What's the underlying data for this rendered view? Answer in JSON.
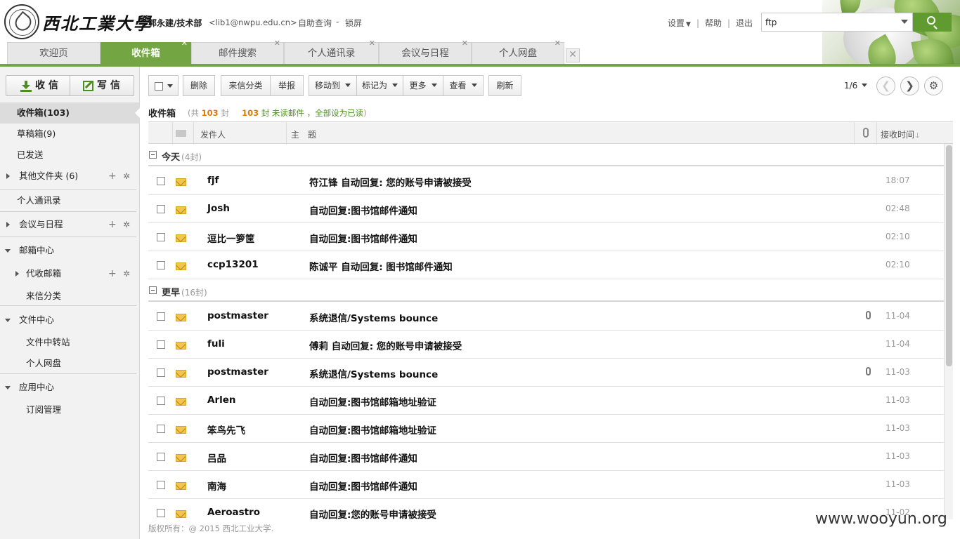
{
  "header": {
    "school_name": "西北工業大學",
    "user_name": "郭永建/技术部",
    "user_email": "<lib1@nwpu.edu.cn>",
    "self_query": "自助查询",
    "separator": "-",
    "lock_screen": "锁屏",
    "settings": "设置",
    "help": "帮助",
    "logout": "退出",
    "search_value": "ftp"
  },
  "tabs": [
    {
      "label": "欢迎页"
    },
    {
      "label": "收件箱"
    },
    {
      "label": "邮件搜索"
    },
    {
      "label": "个人通讯录"
    },
    {
      "label": "会议与日程"
    },
    {
      "label": "个人网盘"
    }
  ],
  "sidebar": {
    "receive_label": "收 信",
    "compose_label": "写 信",
    "folders": {
      "inbox": "收件箱(103)",
      "drafts": "草稿箱(9)",
      "sent": "已发送",
      "other": "其他文件夹 (6)",
      "contacts": "个人通讯录",
      "meetings": "会议与日程",
      "mailbox_center": "邮箱中心",
      "proxy_mailbox": "代收邮箱",
      "mail_classify": "来信分类",
      "file_center": "文件中心",
      "file_transfer": "文件中转站",
      "netdisk": "个人网盘",
      "app_center": "应用中心",
      "subscription": "订阅管理"
    }
  },
  "toolbar": {
    "delete": "删除",
    "classify": "来信分类",
    "report": "举报",
    "move_to": "移动到",
    "mark_as": "标记为",
    "more": "更多",
    "view": "查看",
    "refresh": "刷新",
    "page": "1/6"
  },
  "inbox": {
    "title": "收件箱",
    "total_prefix": "(共",
    "total_count": "103",
    "total_suffix": "封",
    "unread_count": "103",
    "unread_suffix": "封 未读邮件",
    "mark_all_read": "，全部设为已读",
    "close_paren": ")"
  },
  "list_header": {
    "sender": "发件人",
    "subject": "主　题",
    "time": "接收时间"
  },
  "groups": {
    "today": {
      "label": "今天",
      "count": "(4封)"
    },
    "earlier": {
      "label": "更早",
      "count": "(16封)"
    }
  },
  "mails": [
    {
      "sender": "fjf",
      "subject": "符江锋 自动回复: 您的账号申请被接受",
      "time": "18:07",
      "attachment": false
    },
    {
      "sender": "Josh",
      "subject": "自动回复:图书馆邮件通知",
      "time": "02:48",
      "attachment": false
    },
    {
      "sender": "逗比一箩筐",
      "subject": "自动回复:图书馆邮件通知",
      "time": "02:10",
      "attachment": false
    },
    {
      "sender": "ccp13201",
      "subject": "陈诚平 自动回复: 图书馆邮件通知",
      "time": "02:10",
      "attachment": false
    },
    {
      "sender": "postmaster",
      "subject": "系统退信/Systems bounce",
      "time": "11-04",
      "attachment": true
    },
    {
      "sender": "fuli",
      "subject": "傅莉 自动回复: 您的账号申请被接受",
      "time": "11-04",
      "attachment": false
    },
    {
      "sender": "postmaster",
      "subject": "系统退信/Systems bounce",
      "time": "11-03",
      "attachment": true
    },
    {
      "sender": "Arlen",
      "subject": "自动回复:图书馆邮箱地址验证",
      "time": "11-03",
      "attachment": false
    },
    {
      "sender": "笨鸟先飞",
      "subject": "自动回复:图书馆邮箱地址验证",
      "time": "11-03",
      "attachment": false
    },
    {
      "sender": "吕品",
      "subject": "自动回复:图书馆邮件通知",
      "time": "11-03",
      "attachment": false
    },
    {
      "sender": "南海",
      "subject": "自动回复:图书馆邮件通知",
      "time": "11-03",
      "attachment": false
    },
    {
      "sender": "Aeroastro",
      "subject": "自动回复:您的账号申请被接受",
      "time": "11-02",
      "attachment": false
    }
  ],
  "footer": {
    "copyright": "版权所有：@ 2015 西北工业大学.",
    "watermark": "www.wooyun.org"
  },
  "icons": {
    "logo": "university-seal-icon",
    "search": "search-icon",
    "receive": "download-icon",
    "compose": "pencil-icon",
    "envelope": "envelope-icon",
    "attachment": "paperclip-icon",
    "settings": "gear-icon"
  },
  "colors": {
    "accent_green": "#73a542",
    "search_button": "#5f9b2f",
    "count_orange": "#e07b00"
  }
}
